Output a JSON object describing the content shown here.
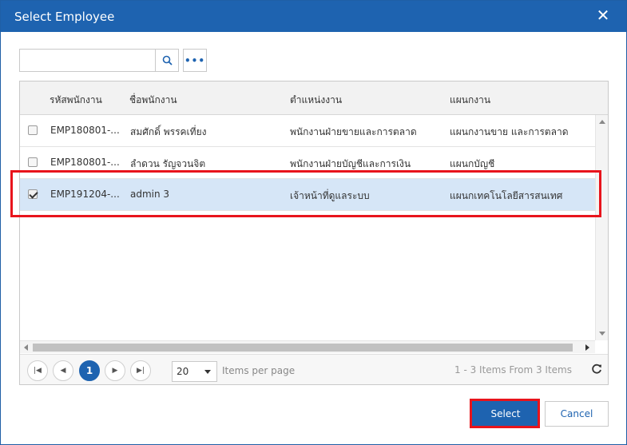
{
  "dialog": {
    "title": "Select Employee"
  },
  "search": {
    "value": "",
    "placeholder": ""
  },
  "grid": {
    "columns": [
      "รหัสพนักงาน",
      "ชื่อพนักงาน",
      "ตำแหน่งงาน",
      "แผนกงาน"
    ],
    "rows": [
      {
        "checked": false,
        "code": "EMP180801-...",
        "name": "สมศักดิ์ พรรคเที่ยง",
        "position": "พนักงานฝ่ายขายและการตลาด",
        "department": "แผนกงานขาย และการตลาด"
      },
      {
        "checked": false,
        "code": "EMP180801-...",
        "name": "ลำดวน รัญจวนจิต",
        "position": "พนักงานฝ่ายบัญชีและการเงิน",
        "department": "แผนกบัญชี"
      },
      {
        "checked": true,
        "code": "EMP191204-...",
        "name": "admin 3",
        "position": "เจ้าหน้าที่ดูแลระบบ",
        "department": "แผนกเทคโนโลยีสารสนเทศ"
      }
    ]
  },
  "pager": {
    "current_page": "1",
    "page_size": "20",
    "items_per_page_label": "Items per page",
    "info": "1 - 3 Items From 3 Items"
  },
  "footer": {
    "select_label": "Select",
    "cancel_label": "Cancel"
  },
  "colors": {
    "primary": "#1e63b0",
    "highlight": "#e8141c",
    "selected_row": "#d6e6f7"
  }
}
